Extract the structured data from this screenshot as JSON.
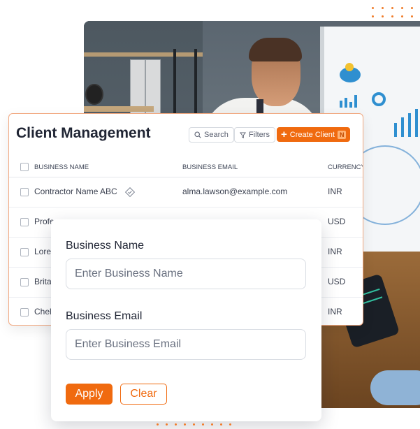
{
  "colors": {
    "accent": "#f06a0f",
    "card_border": "#f1a880",
    "text_dark": "#1f2433"
  },
  "card": {
    "title": "Client Management",
    "search_label": "Search",
    "filters_label": "Filters",
    "create_label": "Create Client",
    "create_shortcut": "N",
    "icons": [
      "search-icon",
      "filter-icon",
      "plus-icon"
    ]
  },
  "table": {
    "columns": [
      "BUSINESS NAME",
      "BUSINESS EMAIL",
      "CURRENCY"
    ],
    "rows": [
      {
        "name": "Contractor Name ABC",
        "email": "alma.lawson@example.com",
        "currency": "INR",
        "verified": true
      },
      {
        "name": "Profe",
        "email": "",
        "currency": "USD",
        "verified": false
      },
      {
        "name": "Loren",
        "email": "",
        "currency": "INR",
        "verified": false
      },
      {
        "name": "Britai",
        "email": "",
        "currency": "USD",
        "verified": false
      },
      {
        "name": "Chels",
        "email": "",
        "currency": "INR",
        "verified": false
      }
    ]
  },
  "filter_popup": {
    "business_name_label": "Business Name",
    "business_name_placeholder": "Enter Business Name",
    "business_email_label": "Business Email",
    "business_email_placeholder": "Enter Business Email",
    "apply_label": "Apply",
    "clear_label": "Clear"
  }
}
